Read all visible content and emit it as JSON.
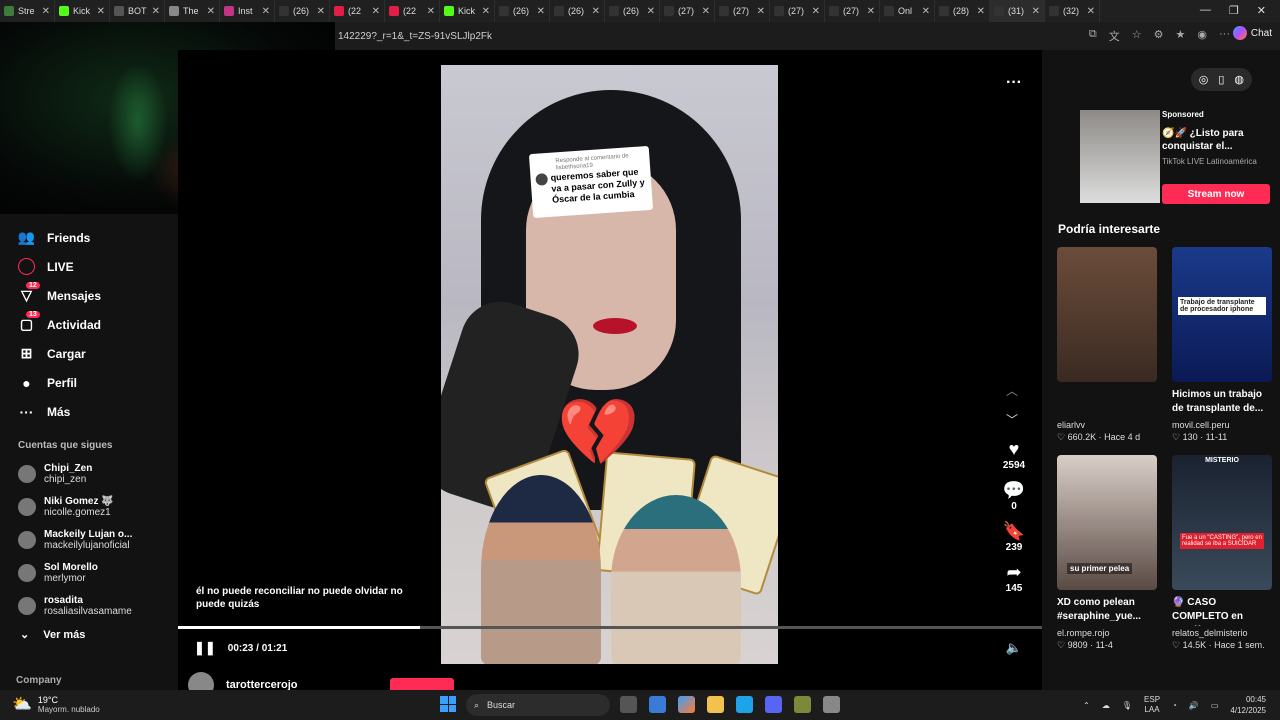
{
  "browser": {
    "tabs": [
      {
        "label": "Stre",
        "color": "#3c7d3c"
      },
      {
        "label": "Kick",
        "color": "#53fc18"
      },
      {
        "label": "BOT",
        "color": "#555555"
      },
      {
        "label": "The",
        "color": "#888888"
      },
      {
        "label": "Inst",
        "color": "#c13584"
      },
      {
        "label": "(26)",
        "color": "#333333"
      },
      {
        "label": "(22",
        "color": "#e11d48"
      },
      {
        "label": "(22",
        "color": "#e11d48"
      },
      {
        "label": "Kick",
        "color": "#53fc18"
      },
      {
        "label": "(26)",
        "color": "#333333"
      },
      {
        "label": "(26)",
        "color": "#333333"
      },
      {
        "label": "(26)",
        "color": "#333333"
      },
      {
        "label": "(27)",
        "color": "#333333"
      },
      {
        "label": "(27)",
        "color": "#333333"
      },
      {
        "label": "(27)",
        "color": "#333333"
      },
      {
        "label": "(27)",
        "color": "#333333"
      },
      {
        "label": "Onl",
        "color": "#333333"
      },
      {
        "label": "(28)",
        "color": "#333333"
      },
      {
        "label": "(31)",
        "color": "#333333"
      },
      {
        "label": "(32)",
        "color": "#333333"
      }
    ],
    "url": "142229?_r=1&_t=ZS-91vSLJlp2Fk",
    "chat_label": "Chat"
  },
  "sidebar": {
    "nav": [
      {
        "label": "Friends",
        "icon": "friends-icon",
        "glyph": "👥",
        "badge": ""
      },
      {
        "label": "LIVE",
        "icon": "live-icon",
        "glyph": "",
        "badge": ""
      },
      {
        "label": "Mensajes",
        "icon": "messages-icon",
        "glyph": "▽",
        "badge": "12"
      },
      {
        "label": "Actividad",
        "icon": "activity-icon",
        "glyph": "▢",
        "badge": "13"
      },
      {
        "label": "Cargar",
        "icon": "upload-icon",
        "glyph": "⊞",
        "badge": ""
      },
      {
        "label": "Perfil",
        "icon": "profile-icon",
        "glyph": "●",
        "badge": ""
      },
      {
        "label": "Más",
        "icon": "more-icon",
        "glyph": "···",
        "badge": ""
      }
    ],
    "following_title": "Cuentas que sigues",
    "following": [
      {
        "name": "Chipi_Zen",
        "handle": "chipi_zen"
      },
      {
        "name": "Niki Gomez 🐺",
        "handle": "nicolle.gomez1"
      },
      {
        "name": "Mackeily Lujan o...",
        "handle": "mackeilylujanoficial"
      },
      {
        "name": "Sol Morello",
        "handle": "merlymor"
      },
      {
        "name": "rosadita",
        "handle": "rosaliasilvasamame"
      }
    ],
    "see_more": "Ver más",
    "company": "Company"
  },
  "video": {
    "sticker_reply": "Responde al comentario de lisbethsoria19",
    "sticker_text": "queremos saber que va a pasar con Zully y Óscar de la cumbia",
    "caption": "él no puede reconciliar no puede olvidar no puede quizás",
    "time": "00:23 / 01:21",
    "progress": 0.28,
    "author": "tarottercerojo",
    "likes": "2594",
    "comments": "0",
    "saves": "239",
    "shares": "145"
  },
  "right": {
    "ad": {
      "sponsored": "Sponsored",
      "title": "🧭🚀 ¿Listo para conquistar el...",
      "sub": "TikTok LIVE Latinoamérica",
      "cta": "Stream now"
    },
    "rec_title": "Podría interesarte",
    "recs": [
      {
        "caption": "",
        "author": "eliarlvv",
        "meta": "♡ 660.2K · Hace 4 d",
        "overlay": "",
        "bg": "linear-gradient(#6b4c3a,#3a2a22)"
      },
      {
        "caption": "Hicimos un trabajo de transplante de...",
        "author": "movil.cell.peru",
        "meta": "♡ 130 · 11-11",
        "overlay": "Trabajo de transplante de procesador iphone",
        "bg": "linear-gradient(#1a3a8a,#0b1a55)"
      },
      {
        "caption": "XD como pelean #seraphine_yue...",
        "author": "el.rompe.rojo",
        "meta": "♡ 9809 · 11-4",
        "overlay": "su primer pelea",
        "bg": "linear-gradient(#d9cfc8,#5a4a44)"
      },
      {
        "caption": "🔮 CASO COMPLETO en Spotify y...",
        "author": "relatos_delmisterio",
        "meta": "♡ 14.5K · Hace 1 sem.",
        "overlay": "Fue a un \"CASTING\", pero en realidad se iba a SUICIDAR",
        "tag": "MISTERIO",
        "bg": "linear-gradient(#1a2230,#3a4a5a)"
      }
    ]
  },
  "taskbar": {
    "temp": "19°C",
    "weather": "Mayorm. nublado",
    "search": "Buscar",
    "lang1": "ESP",
    "lang2": "LAA",
    "time": "00:45",
    "date": "4/12/2025"
  }
}
